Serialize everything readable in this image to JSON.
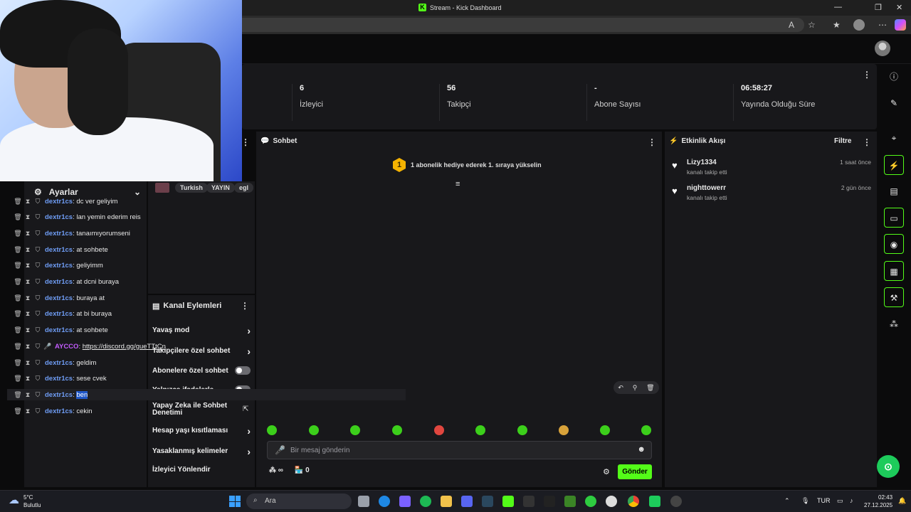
{
  "window": {
    "title": "Stream - Kick Dashboard"
  },
  "stats": [
    {
      "value": "6",
      "label": "İzleyici"
    },
    {
      "value": "56",
      "label": "Takipçi"
    },
    {
      "value": "-",
      "label": "Abone Sayısı"
    },
    {
      "value": "06:58:27",
      "label": "Yayında Olduğu Süre"
    }
  ],
  "left_panel": {
    "settings_label": "Ayarlar"
  },
  "tags": [
    "Turkish",
    "YAYIN",
    "egl"
  ],
  "channel_actions": {
    "title": "Kanal Eylemleri",
    "items": [
      {
        "label": "Yavaş mod",
        "control": "arrow"
      },
      {
        "label": "Takipçilere özel sohbet",
        "control": "arrow"
      },
      {
        "label": "Abonelere özel sohbet",
        "control": "toggle",
        "enabled": false
      },
      {
        "label": "Yalnızca ifadelerle...",
        "control": "toggle",
        "enabled": false
      },
      {
        "label": "Yapay Zeka ile Sohbet Denetimi",
        "control": "external"
      },
      {
        "label": "Hesap yaşı kısıtlaması",
        "control": "arrow"
      },
      {
        "label": "Yasaklanmış kelimeler",
        "control": "arrow"
      },
      {
        "label": "İzleyici Yönlendir",
        "control": "none"
      }
    ]
  },
  "chat": {
    "title": "Sohbet",
    "pinned_rank": "1",
    "pinned_text": "1 abonelik hediye ederek 1. sıraya yükselin",
    "messages": [
      {
        "user": "dextr1cs",
        "text": "dc ver geliyim"
      },
      {
        "user": "dextr1cs",
        "text": "lan yemin ederim reis"
      },
      {
        "user": "dextr1cs",
        "text": "tanaımıyorumseni"
      },
      {
        "user": "dextr1cs",
        "text": "at sohbete"
      },
      {
        "user": "dextr1cs",
        "text": "geliyimm"
      },
      {
        "user": "dextr1cs",
        "text": "at dcni buraya"
      },
      {
        "user": "dextr1cs",
        "text": "buraya at"
      },
      {
        "user": "dextr1cs",
        "text": "at bi buraya"
      },
      {
        "user": "dextr1cs",
        "text": "at sohbete"
      },
      {
        "user": "AYCCO",
        "text": "https://discord.gg/gueTTtCn"
      },
      {
        "user": "dextr1cs",
        "text": "geldim"
      },
      {
        "user": "dextr1cs",
        "text": "sese cvek"
      },
      {
        "user": "dextr1cs",
        "text": "ben"
      },
      {
        "user": "dextr1cs",
        "text": "cekin"
      }
    ],
    "input_placeholder": "Bir mesaj gönderin",
    "infinity_label": "∞",
    "store_count": "0",
    "send_label": "Gönder"
  },
  "activity_feed": {
    "title": "Etkinlik Akışı",
    "filter_label": "Filtre",
    "events": [
      {
        "name": "Lizy1334",
        "action": "kanalı takip etti",
        "time": "1 saat önce"
      },
      {
        "name": "nighttowerr",
        "action": "kanalı takip etti",
        "time": "2 gün önce"
      }
    ]
  },
  "taskbar": {
    "weather_temp": "5°C",
    "weather_desc": "Bulutlu",
    "search_placeholder": "Ara",
    "language": "TUR",
    "time": "02:43",
    "date": "27.12.2025"
  },
  "colors": {
    "accent": "#53fc18",
    "username": "#6f9df5",
    "panel": "#18181b"
  }
}
